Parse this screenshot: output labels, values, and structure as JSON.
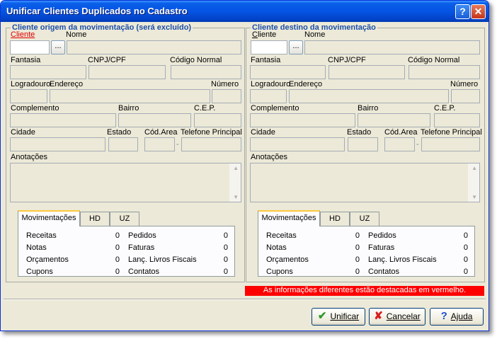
{
  "window": {
    "title": "Unificar Clientes Duplicados no Cadastro",
    "help_btn": "?",
    "close_btn": "✕"
  },
  "origin": {
    "group_title": "Cliente origem da movimentação (será excluído)",
    "cliente_label": "Cliente",
    "nome_label": "Nome",
    "lookup": "...",
    "fantasia_label": "Fantasia",
    "cnpj_label": "CNPJ/CPF",
    "codigo_label": "Código Normal",
    "logradouro_label": "Logradouro",
    "endereco_label": "Endereço",
    "numero_label": "Número",
    "complemento_label": "Complemento",
    "bairro_label": "Bairro",
    "cep_label": "C.E.P.",
    "cidade_label": "Cidade",
    "estado_label": "Estado",
    "codarea_label": "Cód.Area",
    "telefone_label": "Telefone Principal",
    "anotacoes_label": "Anotações",
    "dash": "-",
    "tabs": [
      "Movimentações",
      "HD",
      "UZ"
    ],
    "mov": {
      "receitas": "Receitas",
      "receitas_v": "0",
      "notas": "Notas",
      "notas_v": "0",
      "orcamentos": "Orçamentos",
      "orcamentos_v": "0",
      "cupons": "Cupons",
      "cupons_v": "0",
      "pedidos": "Pedidos",
      "pedidos_v": "0",
      "faturas": "Faturas",
      "faturas_v": "0",
      "lanc": "Lanç. Livros Fiscais",
      "lanc_v": "0",
      "contatos": "Contatos",
      "contatos_v": "0"
    }
  },
  "dest": {
    "group_title": "Cliente destino da movimentação",
    "cliente_label": "Cliente",
    "nome_label": "Nome",
    "lookup": "...",
    "fantasia_label": "Fantasia",
    "cnpj_label": "CNPJ/CPF",
    "codigo_label": "Código Normal",
    "logradouro_label": "Logradouro",
    "endereco_label": "Endereço",
    "numero_label": "Número",
    "complemento_label": "Complemento",
    "bairro_label": "Bairro",
    "cep_label": "C.E.P.",
    "cidade_label": "Cidade",
    "estado_label": "Estado",
    "codarea_label": "Cód.Area",
    "telefone_label": "Telefone Principal",
    "anotacoes_label": "Anotações",
    "dash": "-",
    "tabs": [
      "Movimentações",
      "HD",
      "UZ"
    ],
    "mov": {
      "receitas": "Receitas",
      "receitas_v": "0",
      "notas": "Notas",
      "notas_v": "0",
      "orcamentos": "Orçamentos",
      "orcamentos_v": "0",
      "cupons": "Cupons",
      "cupons_v": "0",
      "pedidos": "Pedidos",
      "pedidos_v": "0",
      "faturas": "Faturas",
      "faturas_v": "0",
      "lanc": "Lanç. Livros Fiscais",
      "lanc_v": "0",
      "contatos": "Contatos",
      "contatos_v": "0"
    }
  },
  "status": {
    "message": "As informações diferentes estão destacadas em vermelho.",
    "color": "#ff0000"
  },
  "buttons": {
    "unificar": "Unificar",
    "cancelar": "Cancelar",
    "ajuda": "Ajuda",
    "unificar_icon": "check-icon",
    "cancelar_icon": "x-icon",
    "ajuda_icon": "question-icon"
  }
}
